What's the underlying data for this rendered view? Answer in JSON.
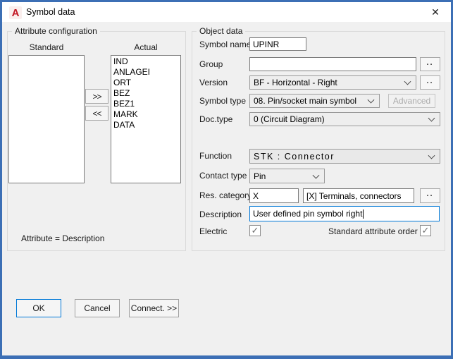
{
  "window": {
    "title": "Symbol data"
  },
  "icons": {
    "close": "✕",
    "check": "✓",
    "app_letter": "A",
    "browse_dots": "..",
    "move_right": ">>",
    "move_left": "<<"
  },
  "colors": {
    "frame_blue": "#3c6fb5",
    "focus_blue": "#0078d7",
    "body_gray": "#f0f0f0",
    "autocad_red": "#c21724"
  },
  "attribute_configuration": {
    "group_label": "Attribute configuration",
    "standard_label": "Standard",
    "actual_label": "Actual",
    "standard_items": [],
    "actual_items": [
      "IND",
      "ANLAGEI",
      "ORT",
      "BEZ",
      "BEZ1",
      "MARK",
      "DATA"
    ],
    "note": "Attribute = Description"
  },
  "object_data": {
    "group_label": "Object data",
    "symbol_name": {
      "label": "Symbol name",
      "value": "UPINR"
    },
    "group": {
      "label": "Group",
      "value": ""
    },
    "version": {
      "label": "Version",
      "value": "BF - Horizontal - Right"
    },
    "symbol_type": {
      "label": "Symbol type",
      "value": "08. Pin/socket main symbol",
      "advanced_label": "Advanced"
    },
    "doc_type": {
      "label": "Doc.type",
      "value": "0 (Circuit Diagram)"
    },
    "function": {
      "label": "Function",
      "value": "STK : Connector"
    },
    "contact_type": {
      "label": "Contact type",
      "value": "Pin"
    },
    "res_category": {
      "label": "Res. category",
      "code": "X",
      "value": "[X] Terminals, connectors"
    },
    "description": {
      "label": "Description",
      "value": "User defined pin symbol right"
    },
    "electric": {
      "label": "Electric",
      "checked": true
    },
    "standard_attribute_order": {
      "label": "Standard attribute order",
      "checked": true
    }
  },
  "footer": {
    "ok": "OK",
    "cancel": "Cancel",
    "connect": "Connect. >>"
  }
}
